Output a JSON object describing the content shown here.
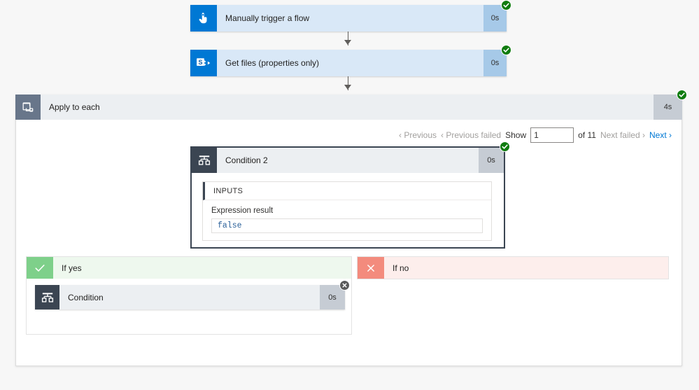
{
  "theme": {
    "page_bg": "#f7f7f7",
    "accent_blue": "#0078d4",
    "card_blue": "#d9e8f7",
    "card_grey": "#eceff2",
    "icon_dark": "#3b4552",
    "success_green": "#107c10",
    "skip_grey": "#5a5a5a",
    "yes_green": "#7ed08a",
    "no_red": "#f38b7d"
  },
  "steps": {
    "trigger": {
      "title": "Manually trigger a flow",
      "duration": "0s",
      "status": "succeeded",
      "icon": "tap-hand-icon"
    },
    "get_files": {
      "title": "Get files (properties only)",
      "duration": "0s",
      "status": "succeeded",
      "icon": "sharepoint-icon"
    },
    "apply_to_each": {
      "title": "Apply to each",
      "duration": "4s",
      "status": "succeeded",
      "icon": "foreach-icon"
    },
    "condition_2": {
      "title": "Condition 2",
      "duration": "0s",
      "status": "succeeded",
      "icon": "condition-icon",
      "inputs": {
        "section_title": "INPUTS",
        "field_label": "Expression result",
        "value": "false"
      }
    },
    "condition": {
      "title": "Condition",
      "duration": "0s",
      "status": "skipped",
      "icon": "condition-icon"
    }
  },
  "pager": {
    "previous": "Previous",
    "previous_failed": "Previous failed",
    "show_label": "Show",
    "show_value": "1",
    "show_placeholder": "",
    "of_label": "of 11",
    "next_failed": "Next failed",
    "next": "Next",
    "chevron_left": "‹",
    "chevron_right": "›"
  },
  "branches": {
    "yes": {
      "label": "If yes",
      "icon": "checkmark-icon"
    },
    "no": {
      "label": "If no",
      "icon": "cross-icon"
    }
  }
}
